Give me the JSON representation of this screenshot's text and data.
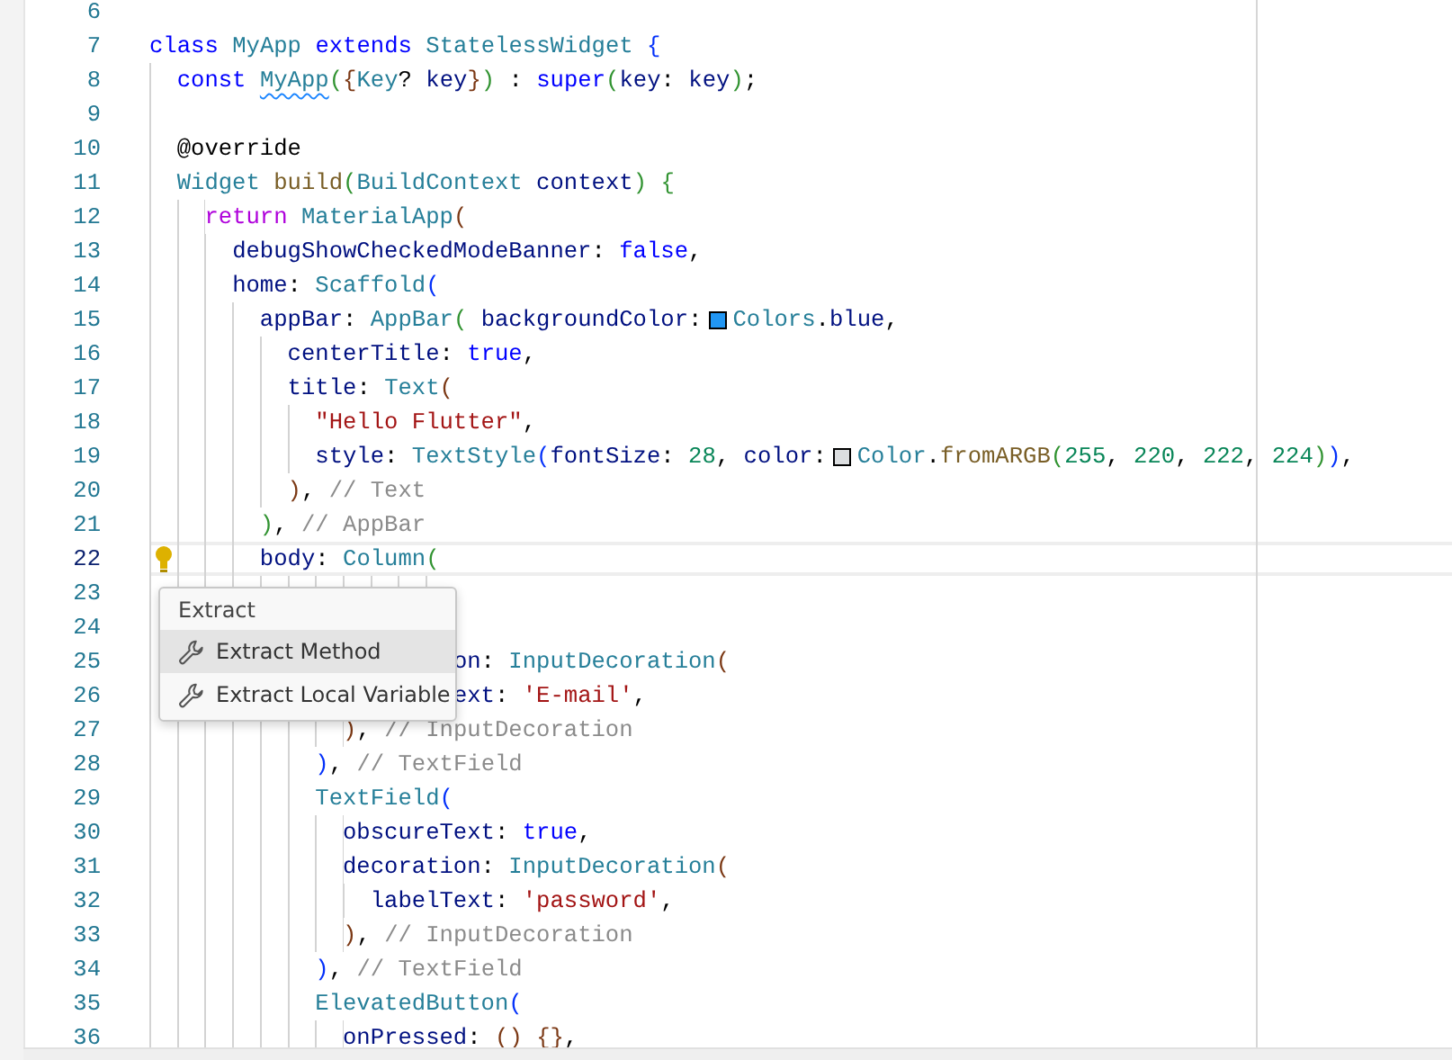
{
  "editor": {
    "lines": [
      {
        "number": "6",
        "active": false,
        "lightbulb": false
      },
      {
        "number": "7",
        "active": false,
        "lightbulb": false,
        "tokens": [
          {
            "kind": "keyword",
            "text": "class"
          },
          {
            "kind": "type",
            "text": " MyApp"
          },
          {
            "kind": "keyword",
            "text": " extends"
          },
          {
            "kind": "type",
            "text": " StatelessWidget"
          },
          {
            "kind": "bracket1",
            "text": " {"
          }
        ]
      },
      {
        "number": "8",
        "active": false,
        "lightbulb": false,
        "tokens": [
          {
            "kind": "keyword",
            "text": "  const"
          },
          {
            "kind": "type-squiggle",
            "text": " MyApp"
          },
          {
            "kind": "bracket2",
            "text": "("
          },
          {
            "kind": "bracket3",
            "text": "{"
          },
          {
            "kind": "type",
            "text": "Key"
          },
          {
            "kind": "punct",
            "text": "?"
          },
          {
            "kind": "var",
            "text": " key"
          },
          {
            "kind": "bracket3",
            "text": "}"
          },
          {
            "kind": "bracket2",
            "text": ")"
          },
          {
            "kind": "punct",
            "text": " :"
          },
          {
            "kind": "keyword",
            "text": " super"
          },
          {
            "kind": "bracket2",
            "text": "("
          },
          {
            "kind": "var",
            "text": "key"
          },
          {
            "kind": "punct",
            "text": ":"
          },
          {
            "kind": "var",
            "text": " key"
          },
          {
            "kind": "bracket2",
            "text": ")"
          },
          {
            "kind": "punct",
            "text": ";"
          }
        ]
      },
      {
        "number": "9",
        "active": false,
        "lightbulb": false
      },
      {
        "number": "10",
        "active": false,
        "lightbulb": false,
        "tokens": [
          {
            "kind": "punct",
            "text": "  @override"
          }
        ]
      },
      {
        "number": "11",
        "active": false,
        "lightbulb": false,
        "tokens": [
          {
            "kind": "type",
            "text": "  Widget"
          },
          {
            "kind": "function",
            "text": " build"
          },
          {
            "kind": "bracket2",
            "text": "("
          },
          {
            "kind": "type",
            "text": "BuildContext"
          },
          {
            "kind": "var",
            "text": " context"
          },
          {
            "kind": "bracket2",
            "text": ")"
          },
          {
            "kind": "bracket2",
            "text": " {"
          }
        ]
      },
      {
        "number": "12",
        "active": false,
        "lightbulb": false,
        "tokens": [
          {
            "kind": "control",
            "text": "    return"
          },
          {
            "kind": "type",
            "text": " MaterialApp"
          },
          {
            "kind": "bracket3",
            "text": "("
          }
        ]
      },
      {
        "number": "13",
        "active": false,
        "lightbulb": false,
        "tokens": [
          {
            "kind": "var",
            "text": "      debugShowCheckedModeBanner"
          },
          {
            "kind": "punct",
            "text": ":"
          },
          {
            "kind": "keyword",
            "text": " false"
          },
          {
            "kind": "punct",
            "text": ","
          }
        ]
      },
      {
        "number": "14",
        "active": false,
        "lightbulb": false,
        "tokens": [
          {
            "kind": "var",
            "text": "      home"
          },
          {
            "kind": "punct",
            "text": ":"
          },
          {
            "kind": "type",
            "text": " Scaffold"
          },
          {
            "kind": "bracket1",
            "text": "("
          }
        ]
      },
      {
        "number": "15",
        "active": false,
        "lightbulb": false,
        "tokens": [
          {
            "kind": "var",
            "text": "        appBar"
          },
          {
            "kind": "punct",
            "text": ":"
          },
          {
            "kind": "type",
            "text": " AppBar"
          },
          {
            "kind": "bracket2",
            "text": "("
          },
          {
            "kind": "var",
            "text": " backgroundColor"
          },
          {
            "kind": "punct",
            "text": ":"
          },
          {
            "kind": "swatch",
            "color": "#2196f3"
          },
          {
            "kind": "type",
            "text": "Colors"
          },
          {
            "kind": "punct",
            "text": "."
          },
          {
            "kind": "var",
            "text": "blue"
          },
          {
            "kind": "punct",
            "text": ","
          }
        ]
      },
      {
        "number": "16",
        "active": false,
        "lightbulb": false,
        "tokens": [
          {
            "kind": "var",
            "text": "          centerTitle"
          },
          {
            "kind": "punct",
            "text": ":"
          },
          {
            "kind": "keyword",
            "text": " true"
          },
          {
            "kind": "punct",
            "text": ","
          }
        ]
      },
      {
        "number": "17",
        "active": false,
        "lightbulb": false,
        "tokens": [
          {
            "kind": "var",
            "text": "          title"
          },
          {
            "kind": "punct",
            "text": ":"
          },
          {
            "kind": "type",
            "text": " Text"
          },
          {
            "kind": "bracket3",
            "text": "("
          }
        ]
      },
      {
        "number": "18",
        "active": false,
        "lightbulb": false,
        "tokens": [
          {
            "kind": "string",
            "text": "            \"Hello Flutter\""
          },
          {
            "kind": "punct",
            "text": ","
          }
        ]
      },
      {
        "number": "19",
        "active": false,
        "lightbulb": false,
        "tokens": [
          {
            "kind": "var",
            "text": "            style"
          },
          {
            "kind": "punct",
            "text": ":"
          },
          {
            "kind": "type",
            "text": " TextStyle"
          },
          {
            "kind": "bracket1",
            "text": "("
          },
          {
            "kind": "var",
            "text": "fontSize"
          },
          {
            "kind": "punct",
            "text": ":"
          },
          {
            "kind": "number",
            "text": " 28"
          },
          {
            "kind": "punct",
            "text": ","
          },
          {
            "kind": "var",
            "text": " color"
          },
          {
            "kind": "punct",
            "text": ":"
          },
          {
            "kind": "swatch",
            "color": "#dcdee0"
          },
          {
            "kind": "type",
            "text": "Color"
          },
          {
            "kind": "punct",
            "text": "."
          },
          {
            "kind": "function",
            "text": "fromARGB"
          },
          {
            "kind": "bracket2",
            "text": "("
          },
          {
            "kind": "number",
            "text": "255"
          },
          {
            "kind": "punct",
            "text": ","
          },
          {
            "kind": "number",
            "text": " 220"
          },
          {
            "kind": "punct",
            "text": ","
          },
          {
            "kind": "number",
            "text": " 222"
          },
          {
            "kind": "punct",
            "text": ","
          },
          {
            "kind": "number",
            "text": " 224"
          },
          {
            "kind": "bracket2",
            "text": ")"
          },
          {
            "kind": "bracket1",
            "text": ")"
          },
          {
            "kind": "punct",
            "text": ","
          }
        ]
      },
      {
        "number": "20",
        "active": false,
        "lightbulb": false,
        "tokens": [
          {
            "kind": "bracket3",
            "text": "          )"
          },
          {
            "kind": "punct",
            "text": ","
          },
          {
            "kind": "hint",
            "text": " // Text"
          }
        ]
      },
      {
        "number": "21",
        "active": false,
        "lightbulb": false,
        "tokens": [
          {
            "kind": "bracket2",
            "text": "        )"
          },
          {
            "kind": "punct",
            "text": ","
          },
          {
            "kind": "hint",
            "text": " // AppBar"
          }
        ]
      },
      {
        "number": "22",
        "active": true,
        "lightbulb": true,
        "tokens": [
          {
            "kind": "var",
            "text": "        body"
          },
          {
            "kind": "punct",
            "text": ":"
          },
          {
            "kind": "type",
            "text": " Column"
          },
          {
            "kind": "bracket2",
            "text": "("
          }
        ]
      },
      {
        "number": "23",
        "active": false,
        "lightbulb": false
      },
      {
        "number": "24",
        "active": false,
        "lightbulb": false
      },
      {
        "number": "25",
        "active": false,
        "lightbulb": false,
        "tokens": [
          {
            "kind": "var",
            "text": "                      on"
          },
          {
            "kind": "punct",
            "text": ":"
          },
          {
            "kind": "type",
            "text": " InputDecoration"
          },
          {
            "kind": "bracket3",
            "text": "("
          }
        ]
      },
      {
        "number": "26",
        "active": false,
        "lightbulb": false,
        "tokens": [
          {
            "kind": "var",
            "text": "                      ext"
          },
          {
            "kind": "punct",
            "text": ":"
          },
          {
            "kind": "string",
            "text": " 'E-mail'"
          },
          {
            "kind": "punct",
            "text": ","
          }
        ]
      },
      {
        "number": "27",
        "active": false,
        "lightbulb": false,
        "tokens": [
          {
            "kind": "bracket3",
            "text": "              )"
          },
          {
            "kind": "punct",
            "text": ","
          },
          {
            "kind": "hint",
            "text": " // InputDecoration"
          }
        ]
      },
      {
        "number": "28",
        "active": false,
        "lightbulb": false,
        "tokens": [
          {
            "kind": "bracket1",
            "text": "            )"
          },
          {
            "kind": "punct",
            "text": ","
          },
          {
            "kind": "hint",
            "text": " // TextField"
          }
        ]
      },
      {
        "number": "29",
        "active": false,
        "lightbulb": false,
        "tokens": [
          {
            "kind": "type",
            "text": "            TextField"
          },
          {
            "kind": "bracket1",
            "text": "("
          }
        ]
      },
      {
        "number": "30",
        "active": false,
        "lightbulb": false,
        "tokens": [
          {
            "kind": "var",
            "text": "              obscureText"
          },
          {
            "kind": "punct",
            "text": ":"
          },
          {
            "kind": "keyword",
            "text": " true"
          },
          {
            "kind": "punct",
            "text": ","
          }
        ]
      },
      {
        "number": "31",
        "active": false,
        "lightbulb": false,
        "tokens": [
          {
            "kind": "var",
            "text": "              decoration"
          },
          {
            "kind": "punct",
            "text": ":"
          },
          {
            "kind": "type",
            "text": " InputDecoration"
          },
          {
            "kind": "bracket3",
            "text": "("
          }
        ]
      },
      {
        "number": "32",
        "active": false,
        "lightbulb": false,
        "tokens": [
          {
            "kind": "var",
            "text": "                labelText"
          },
          {
            "kind": "punct",
            "text": ":"
          },
          {
            "kind": "string",
            "text": " 'password'"
          },
          {
            "kind": "punct",
            "text": ","
          }
        ]
      },
      {
        "number": "33",
        "active": false,
        "lightbulb": false,
        "tokens": [
          {
            "kind": "bracket3",
            "text": "              )"
          },
          {
            "kind": "punct",
            "text": ","
          },
          {
            "kind": "hint",
            "text": " // InputDecoration"
          }
        ]
      },
      {
        "number": "34",
        "active": false,
        "lightbulb": false,
        "tokens": [
          {
            "kind": "bracket1",
            "text": "            )"
          },
          {
            "kind": "punct",
            "text": ","
          },
          {
            "kind": "hint",
            "text": " // TextField"
          }
        ]
      },
      {
        "number": "35",
        "active": false,
        "lightbulb": false,
        "tokens": [
          {
            "kind": "type",
            "text": "            ElevatedButton"
          },
          {
            "kind": "bracket1",
            "text": "("
          }
        ]
      },
      {
        "number": "36",
        "active": false,
        "lightbulb": false,
        "tokens": [
          {
            "kind": "var",
            "text": "              onPressed"
          },
          {
            "kind": "punct",
            "text": ":"
          },
          {
            "kind": "bracket3",
            "text": " ("
          },
          {
            "kind": "bracket3",
            "text": ")"
          },
          {
            "kind": "bracket3",
            "text": " {"
          },
          {
            "kind": "bracket3",
            "text": "}"
          },
          {
            "kind": "punct",
            "text": ","
          }
        ]
      }
    ]
  },
  "context_menu": {
    "title": "Extract",
    "items": [
      {
        "label": "Extract Method",
        "selected": true
      },
      {
        "label": "Extract Local Variable",
        "selected": false
      }
    ]
  }
}
